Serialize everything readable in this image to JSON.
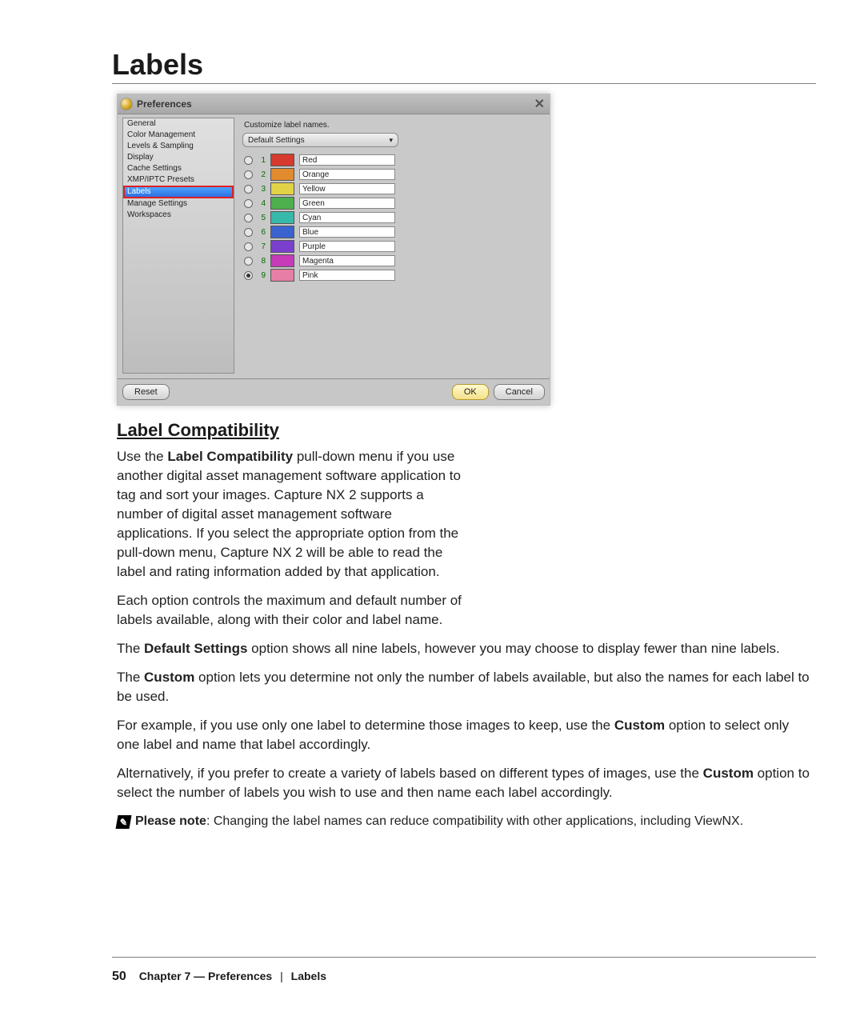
{
  "page": {
    "heading": "Labels",
    "subheading": "Label Compatibility",
    "footer": {
      "page_number": "50",
      "chapter": "Chapter 7 — Preferences",
      "section": "Labels"
    }
  },
  "screenshot": {
    "title": "Preferences",
    "main_heading": "Customize label names.",
    "dropdown_value": "Default Settings",
    "sidebar": [
      "General",
      "Color Management",
      "Levels & Sampling",
      "Display",
      "Cache Settings",
      "XMP/IPTC Presets",
      "Labels",
      "Manage Settings",
      "Workspaces"
    ],
    "labels": [
      {
        "num": "1",
        "color": "#D63A2E",
        "name": "Red",
        "selected": false
      },
      {
        "num": "2",
        "color": "#E18A2E",
        "name": "Orange",
        "selected": false
      },
      {
        "num": "3",
        "color": "#E2D246",
        "name": "Yellow",
        "selected": false
      },
      {
        "num": "4",
        "color": "#4DB04D",
        "name": "Green",
        "selected": false
      },
      {
        "num": "5",
        "color": "#37B9A9",
        "name": "Cyan",
        "selected": false
      },
      {
        "num": "6",
        "color": "#3B63CE",
        "name": "Blue",
        "selected": false
      },
      {
        "num": "7",
        "color": "#7B3FCE",
        "name": "Purple",
        "selected": false
      },
      {
        "num": "8",
        "color": "#C63BB8",
        "name": "Magenta",
        "selected": false
      },
      {
        "num": "9",
        "color": "#E67EA5",
        "name": "Pink",
        "selected": true
      }
    ],
    "buttons": {
      "reset": "Reset",
      "ok": "OK",
      "cancel": "Cancel"
    }
  },
  "body": {
    "p1_pre": "Use the ",
    "p1_bold": "Label Compatibility",
    "p1_post": " pull-down menu if you use another digital asset management software application to tag and sort your images. Capture NX 2 supports a number of digital asset management software applications. If you select the appropriate option from the pull-down menu, Capture NX 2 will be able to read the label and rating information added by that application.",
    "p2": "Each option controls the maximum and default number of labels available, along with their color and label name.",
    "p3_pre": "The ",
    "p3_bold": "Default Settings",
    "p3_post": " option shows all nine labels, however you may choose to display fewer than nine labels.",
    "p4_pre": "The ",
    "p4_bold": "Custom",
    "p4_post": " option lets you determine not only the number of labels available, but also the names for each label to be used.",
    "p5_pre": "For example, if you use only one label to determine those images to keep, use the ",
    "p5_bold": "Custom",
    "p5_post": " option to select only one label and name that label accordingly.",
    "p6_pre": "Alternatively, if you prefer to create a variety of labels based on different types of images, use the ",
    "p6_bold": "Custom",
    "p6_post": " option to select the number of labels you wish to use and then name each label accordingly.",
    "note_label": "Please note",
    "note_text": ": Changing the label names can reduce compatibility with other applications, including ViewNX."
  }
}
